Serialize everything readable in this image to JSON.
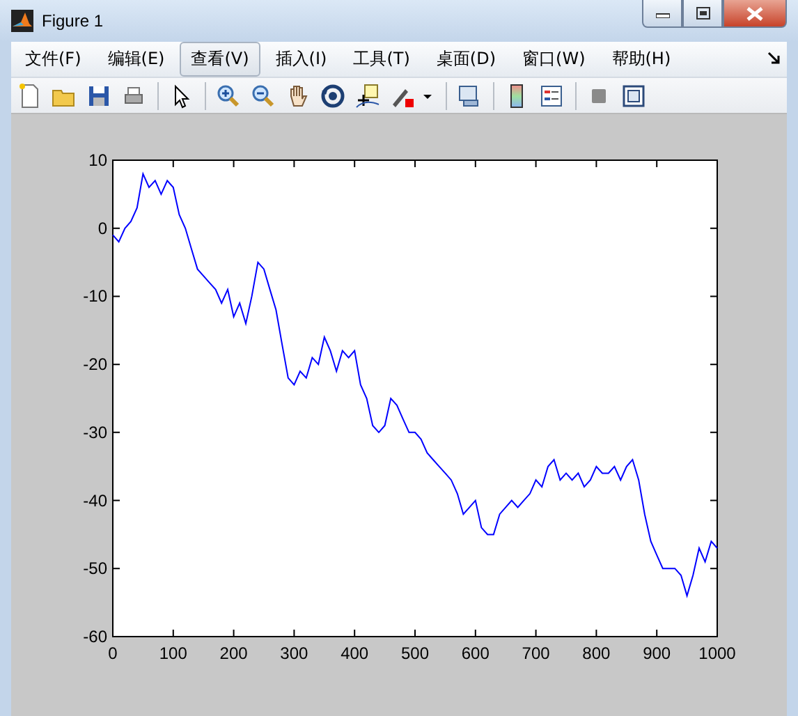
{
  "window": {
    "title": "Figure 1"
  },
  "menu": [
    {
      "label": "文件(F)",
      "selected": false
    },
    {
      "label": "编辑(E)",
      "selected": false
    },
    {
      "label": "查看(V)",
      "selected": true
    },
    {
      "label": "插入(I)",
      "selected": false
    },
    {
      "label": "工具(T)",
      "selected": false
    },
    {
      "label": "桌面(D)",
      "selected": false
    },
    {
      "label": "窗口(W)",
      "selected": false
    },
    {
      "label": "帮助(H)",
      "selected": false
    }
  ],
  "axes": {
    "chart_data": {
      "type": "line",
      "xlim": [
        0,
        1000
      ],
      "ylim": [
        -60,
        10
      ],
      "xticks": [
        0,
        100,
        200,
        300,
        400,
        500,
        600,
        700,
        800,
        900,
        1000
      ],
      "yticks": [
        -60,
        -50,
        -40,
        -30,
        -20,
        -10,
        0,
        10
      ],
      "x": [
        0,
        10,
        20,
        30,
        40,
        50,
        60,
        70,
        80,
        90,
        100,
        110,
        120,
        130,
        140,
        150,
        160,
        170,
        180,
        190,
        200,
        210,
        220,
        230,
        240,
        250,
        260,
        270,
        280,
        290,
        300,
        310,
        320,
        330,
        340,
        350,
        360,
        370,
        380,
        390,
        400,
        410,
        420,
        430,
        440,
        450,
        460,
        470,
        480,
        490,
        500,
        510,
        520,
        530,
        540,
        550,
        560,
        570,
        580,
        590,
        600,
        610,
        620,
        630,
        640,
        650,
        660,
        670,
        680,
        690,
        700,
        710,
        720,
        730,
        740,
        750,
        760,
        770,
        780,
        790,
        800,
        810,
        820,
        830,
        840,
        850,
        860,
        870,
        880,
        890,
        900,
        910,
        920,
        930,
        940,
        950,
        960,
        970,
        980,
        990,
        1000
      ],
      "series": [
        {
          "color": "#0000ff",
          "values": [
            -1,
            -2,
            0,
            1,
            3,
            8,
            6,
            7,
            5,
            7,
            6,
            2,
            0,
            -3,
            -6,
            -7,
            -8,
            -9,
            -11,
            -9,
            -13,
            -11,
            -14,
            -10,
            -5,
            -6,
            -9,
            -12,
            -17,
            -22,
            -23,
            -21,
            -22,
            -19,
            -20,
            -16,
            -18,
            -21,
            -18,
            -19,
            -18,
            -23,
            -25,
            -29,
            -30,
            -29,
            -25,
            -26,
            -28,
            -30,
            -30,
            -31,
            -33,
            -34,
            -35,
            -36,
            -37,
            -39,
            -42,
            -41,
            -40,
            -44,
            -45,
            -45,
            -42,
            -41,
            -40,
            -41,
            -40,
            -39,
            -37,
            -38,
            -35,
            -34,
            -37,
            -36,
            -37,
            -36,
            -38,
            -37,
            -35,
            -36,
            -36,
            -35,
            -37,
            -35,
            -34,
            -37,
            -42,
            -46,
            -48,
            -50,
            -50,
            -50,
            -51,
            -54,
            -51,
            -47,
            -49,
            -46,
            -47
          ]
        }
      ]
    }
  }
}
